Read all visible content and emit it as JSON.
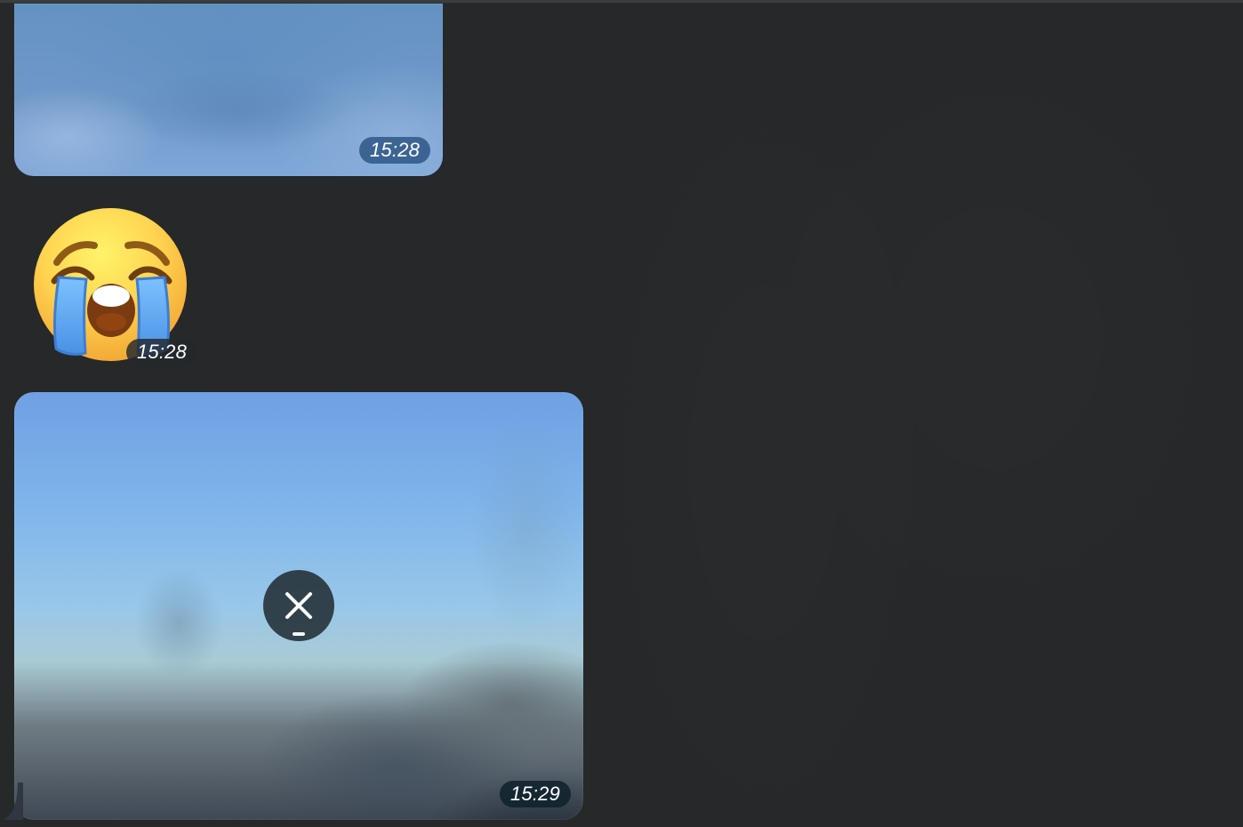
{
  "chat": {
    "messages": [
      {
        "type": "photo",
        "time": "15:28"
      },
      {
        "type": "emoji",
        "emoji_name": "loudly-crying-face",
        "time": "15:28"
      },
      {
        "type": "photo",
        "time": "15:29",
        "download_state": "in-progress",
        "cancel_icon": "close-icon"
      }
    ]
  },
  "colors": {
    "background": "#26282a",
    "photo1_badge": "#1e4878",
    "emoji_badge": "#23282e",
    "photo2_badge": "#0e212b",
    "cancel_button": "#26323a"
  }
}
